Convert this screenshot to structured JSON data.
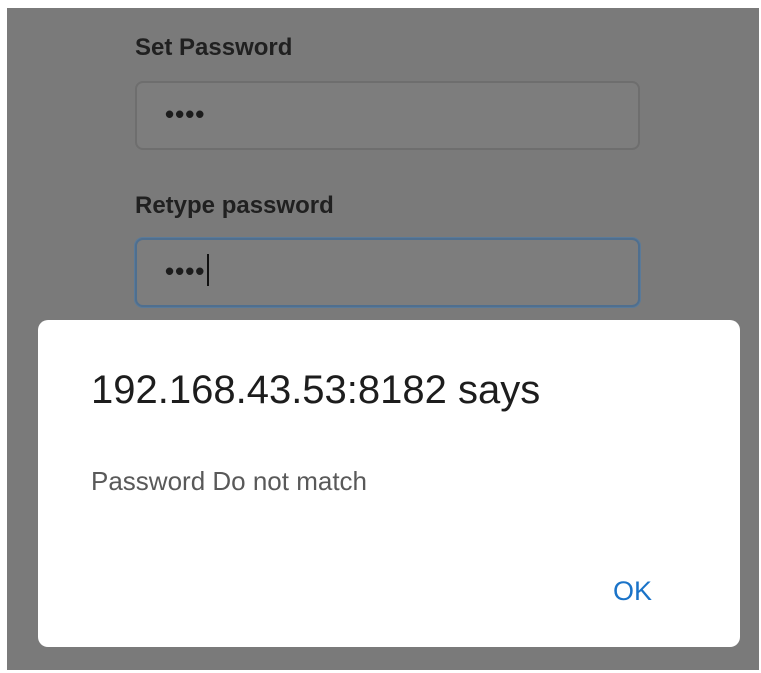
{
  "form": {
    "set_password": {
      "label": "Set Password",
      "value": "••••"
    },
    "retype_password": {
      "label": "Retype password",
      "value": "••••"
    }
  },
  "dialog": {
    "title": "192.168.43.53:8182 says",
    "message": "Password Do not match",
    "ok_label": "OK"
  },
  "colors": {
    "overlay": "#7a7a7a",
    "dialog_bg": "#ffffff",
    "ok_button": "#1a73c8"
  }
}
